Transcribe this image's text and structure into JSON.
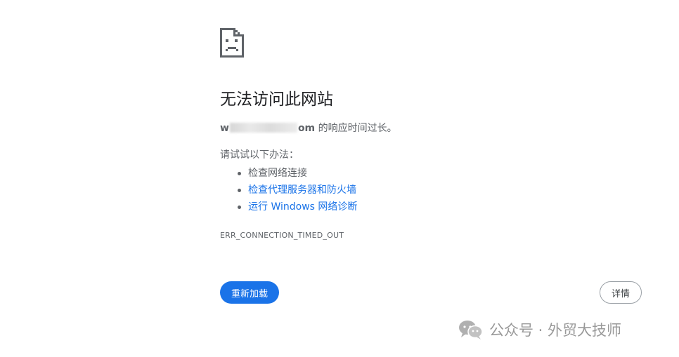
{
  "error": {
    "heading": "无法访问此网站",
    "host_prefix": "w",
    "host_suffix": "om",
    "subtitle_rest": " 的响应时间过长。",
    "try_label": "请试试以下办法：",
    "suggestions": [
      {
        "label": "检查网络连接",
        "link": false
      },
      {
        "label": "检查代理服务器和防火墙",
        "link": true
      },
      {
        "label": "运行 Windows 网络诊断",
        "link": true
      }
    ],
    "code": "ERR_CONNECTION_TIMED_OUT"
  },
  "buttons": {
    "reload": "重新加载",
    "details": "详情"
  },
  "watermark": {
    "text": "公众号 · 外贸大技师",
    "icon": "wechat-icon"
  },
  "colors": {
    "accent": "#1a73e8",
    "text": "#202124",
    "secondary": "#5f6368"
  }
}
